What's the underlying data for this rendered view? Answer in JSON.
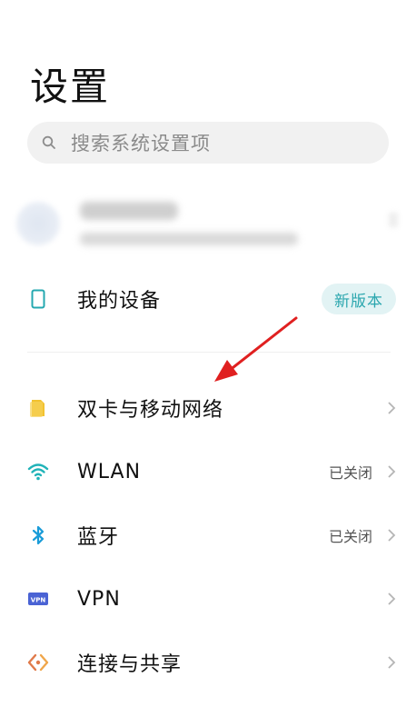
{
  "header": {
    "title": "设置"
  },
  "search": {
    "placeholder": "搜索系统设置项"
  },
  "device_row": {
    "label": "我的设备",
    "badge": "新版本"
  },
  "items": [
    {
      "label": "双卡与移动网络",
      "status": "",
      "icon": "sim-card-icon",
      "color": "#f2c230"
    },
    {
      "label": "WLAN",
      "status": "已关闭",
      "icon": "wifi-icon",
      "color": "#20b3b8"
    },
    {
      "label": "蓝牙",
      "status": "已关闭",
      "icon": "bluetooth-icon",
      "color": "#1a9cd8"
    },
    {
      "label": "VPN",
      "status": "",
      "icon": "vpn-icon",
      "color": "#4a63d4"
    },
    {
      "label": "连接与共享",
      "status": "",
      "icon": "connection-share-icon",
      "color": "#e07a4a"
    }
  ],
  "colors": {
    "accent": "#2aa6ae",
    "annotation_arrow": "#e02020"
  }
}
